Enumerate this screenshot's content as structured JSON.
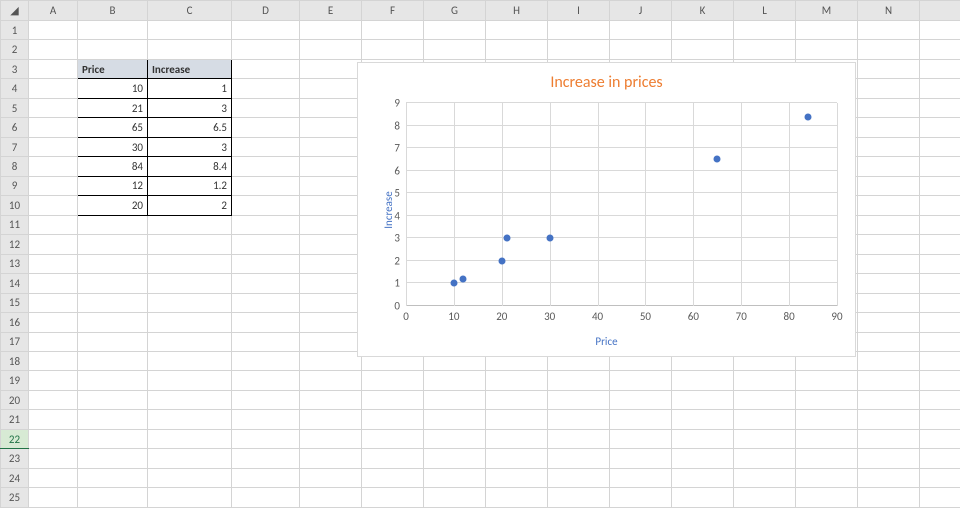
{
  "columns": [
    "A",
    "B",
    "C",
    "D",
    "E",
    "F",
    "G",
    "H",
    "I",
    "J",
    "K",
    "L",
    "M",
    "N"
  ],
  "rows": [
    "1",
    "2",
    "3",
    "4",
    "5",
    "6",
    "7",
    "8",
    "9",
    "10",
    "11",
    "12",
    "13",
    "14",
    "15",
    "16",
    "17",
    "18",
    "19",
    "20",
    "21",
    "22",
    "23",
    "24",
    "25"
  ],
  "selected_row": "22",
  "table": {
    "headers": {
      "price": "Price",
      "increase": "Increase"
    },
    "rows": [
      {
        "price": "10",
        "increase": "1"
      },
      {
        "price": "21",
        "increase": "3"
      },
      {
        "price": "65",
        "increase": "6.5"
      },
      {
        "price": "30",
        "increase": "3"
      },
      {
        "price": "84",
        "increase": "8.4"
      },
      {
        "price": "12",
        "increase": "1.2"
      },
      {
        "price": "20",
        "increase": "2"
      }
    ]
  },
  "chart_data": {
    "type": "scatter",
    "title": "Increase in prices",
    "xlabel": "Price",
    "ylabel": "Increase",
    "xlim": [
      0,
      90
    ],
    "ylim": [
      0,
      9
    ],
    "xticks": [
      0,
      10,
      20,
      30,
      40,
      50,
      60,
      70,
      80,
      90
    ],
    "yticks": [
      0,
      1,
      2,
      3,
      4,
      5,
      6,
      7,
      8,
      9
    ],
    "series": [
      {
        "name": "Increase",
        "points": [
          {
            "x": 10,
            "y": 1
          },
          {
            "x": 21,
            "y": 3
          },
          {
            "x": 65,
            "y": 6.5
          },
          {
            "x": 30,
            "y": 3
          },
          {
            "x": 84,
            "y": 8.4
          },
          {
            "x": 12,
            "y": 1.2
          },
          {
            "x": 20,
            "y": 2
          }
        ]
      }
    ]
  }
}
